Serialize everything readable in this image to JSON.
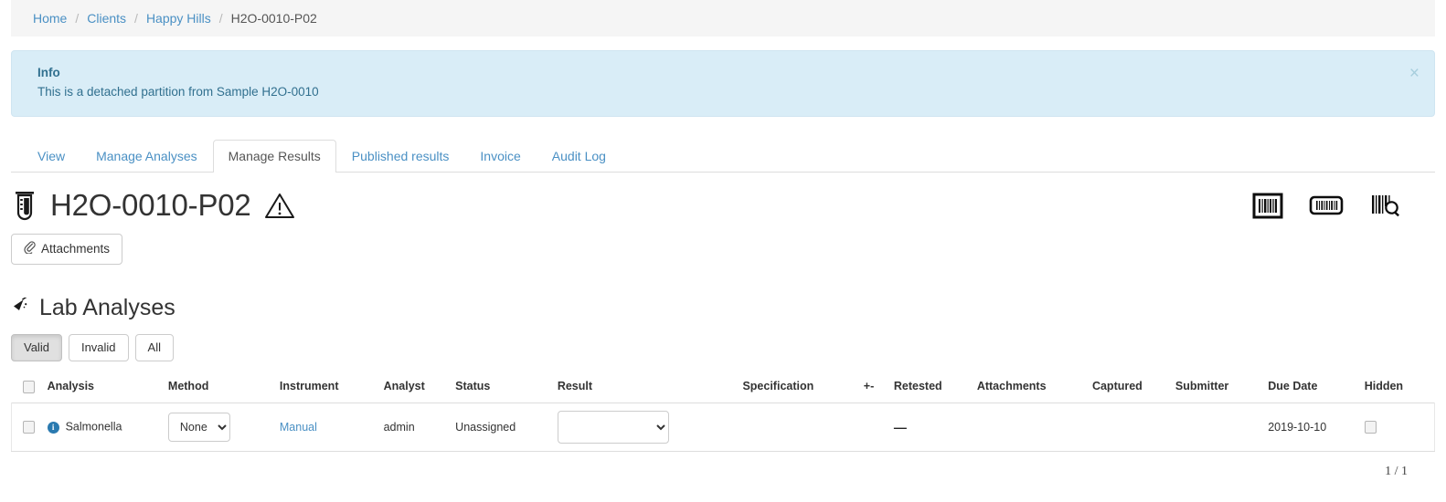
{
  "breadcrumb": {
    "items": [
      {
        "label": "Home",
        "link": true
      },
      {
        "label": "Clients",
        "link": true
      },
      {
        "label": "Happy Hills",
        "link": true
      },
      {
        "label": "H2O-0010-P02",
        "link": false
      }
    ],
    "separator": "/"
  },
  "alert": {
    "title": "Info",
    "message": "This is a detached partition from Sample H2O-0010",
    "close_label": "×",
    "bg_color": "#d9edf7",
    "text_color": "#31708f"
  },
  "tabs": [
    {
      "label": "View",
      "active": false
    },
    {
      "label": "Manage Analyses",
      "active": false
    },
    {
      "label": "Manage Results",
      "active": true
    },
    {
      "label": "Published results",
      "active": false
    },
    {
      "label": "Invoice",
      "active": false
    },
    {
      "label": "Audit Log",
      "active": false
    }
  ],
  "header": {
    "title": "H2O-0010-P02",
    "sample_icon": "sample-tube-icon",
    "warning_icon": "warning-triangle-icon",
    "right_icons": [
      {
        "name": "barcode-square-icon"
      },
      {
        "name": "barcode-label-icon"
      },
      {
        "name": "barcode-search-icon"
      }
    ]
  },
  "toolbar": {
    "attachments_label": "Attachments",
    "attachments_icon": "paperclip-icon"
  },
  "section": {
    "title": "Lab Analyses",
    "icon": "flask-icon"
  },
  "filters": [
    {
      "label": "Valid",
      "active": true
    },
    {
      "label": "Invalid",
      "active": false
    },
    {
      "label": "All",
      "active": false
    }
  ],
  "table": {
    "columns": [
      "Analysis",
      "Method",
      "Instrument",
      "Analyst",
      "Status",
      "Result",
      "Specification",
      "+-",
      "Retested",
      "Attachments",
      "Captured",
      "Submitter",
      "Due Date",
      "Hidden"
    ],
    "rows": [
      {
        "selected": false,
        "analysis": "Salmonella",
        "info_icon": "info-icon",
        "method": "None",
        "method_options": [
          "None"
        ],
        "instrument": "Manual",
        "analyst": "admin",
        "status": "Unassigned",
        "result": "",
        "result_options": [
          ""
        ],
        "specification": "",
        "uncertainty": "",
        "retested": "—",
        "attachments": "",
        "captured": "",
        "submitter": "",
        "due_date": "2019-10-10",
        "hidden": false
      }
    ]
  },
  "pagination": {
    "label": "1 / 1"
  }
}
